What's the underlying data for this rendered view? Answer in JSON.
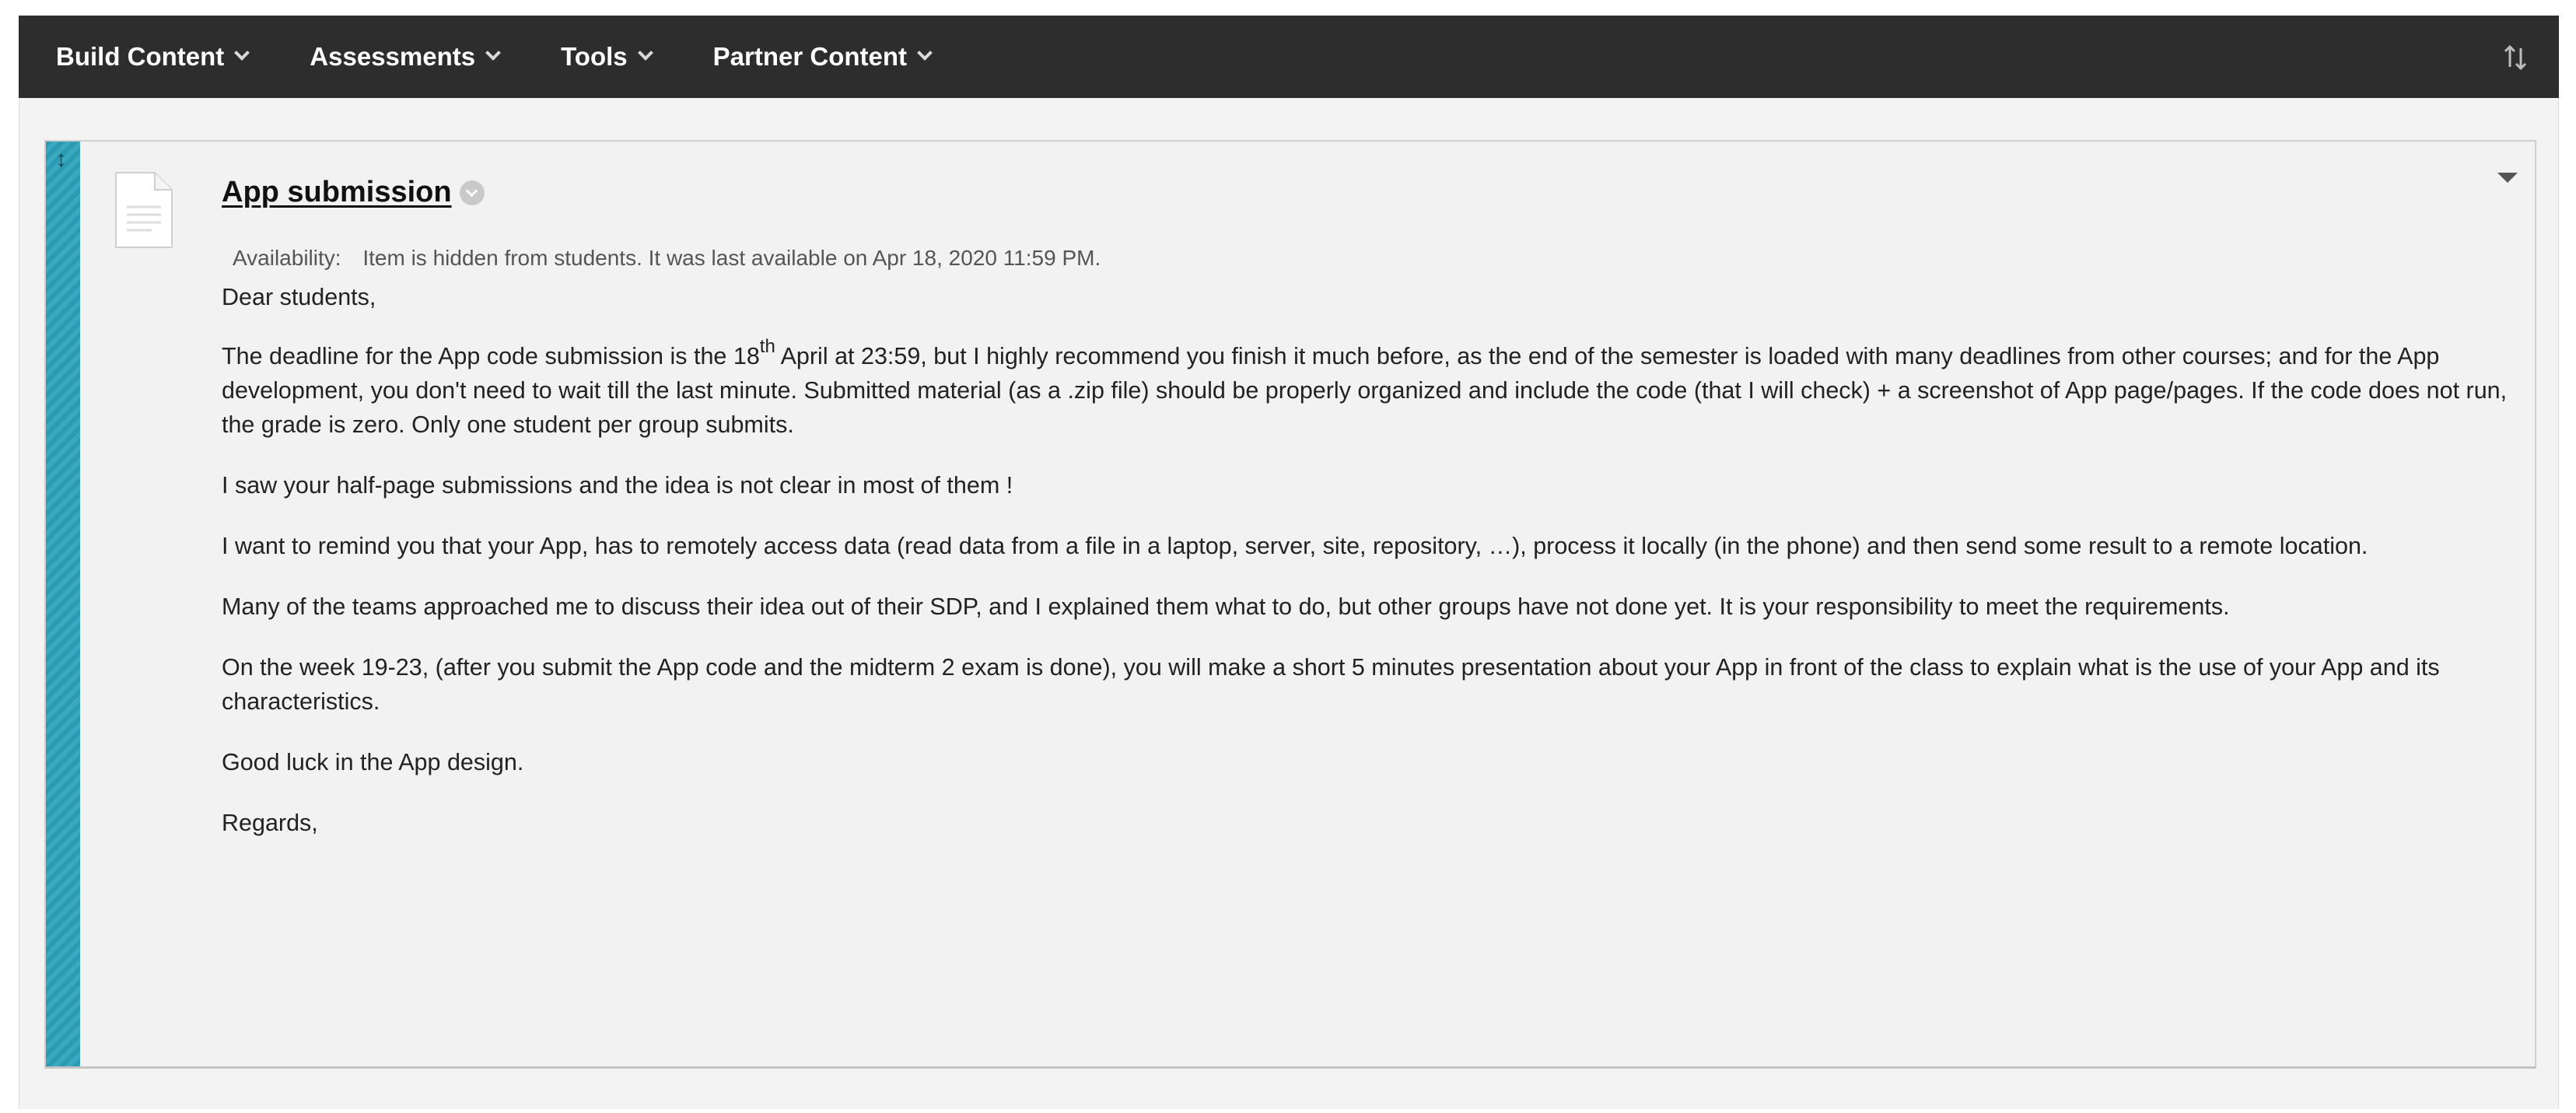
{
  "toolbar": {
    "menus": [
      {
        "label": "Build Content"
      },
      {
        "label": "Assessments"
      },
      {
        "label": "Tools"
      },
      {
        "label": "Partner Content"
      }
    ],
    "reorder_icon": "sort-arrows-icon"
  },
  "item": {
    "title": "App submission",
    "icon": "document-icon",
    "availability_label": "Availability:",
    "availability_text": "Item is hidden from students. It was last available on Apr 18, 2020 11:59 PM.",
    "body": {
      "greeting": "Dear students,",
      "p1_before": "The deadline for the App code submission is the 18",
      "p1_sup": "th",
      "p1_after": " April at 23:59, but I highly recommend you finish it much before, as the end of the semester is loaded with many deadlines from other courses; and for the App development, you don't need to wait till the last minute. Submitted material (as a .zip file) should be properly organized and include the code (that I will check) + a screenshot of App page/pages. If the code does not run, the grade is zero. Only one student per group submits.",
      "p2": "I saw your half-page submissions and the idea is not clear in most of them !",
      "p3": "I want to remind you that your App, has to remotely access data (read data from a file in a laptop, server, site, repository, …), process it locally (in the phone) and then send some result to a remote location.",
      "p4": "Many of the teams approached me to discuss their idea out of their SDP, and I explained them what to do, but other groups have not done yet. It is your responsibility to meet the requirements.",
      "p5": "On the week 19-23, (after you submit the App code and the midterm 2 exam is done), you will make a short 5 minutes presentation about your App in front of the class to explain what is the use of your App and its characteristics.",
      "p6": "Good luck in the App design.",
      "closing": "Regards,"
    }
  },
  "colors": {
    "toolbar_bg": "#2d2d2d",
    "drag_handle": "#2b9bb3",
    "content_bg": "#f2f2f2"
  }
}
